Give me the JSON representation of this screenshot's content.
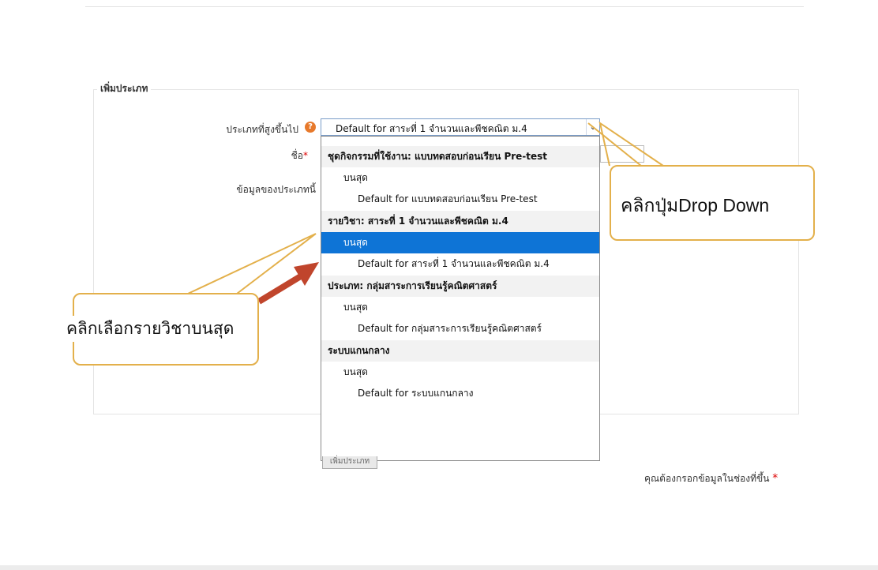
{
  "form": {
    "legend": "เพิ่มประเภท",
    "parent_category_label": "ประเภทที่สูงขึ้นไป",
    "help_icon": "help-icon",
    "name_label": "ชื่อ",
    "required_mark": "*",
    "info_label": "ข้อมูลของประเภทนี้",
    "parent_category_value": "Default for สาระที่ 1 จำนวนและพีชคณิต ม.4",
    "arrow_glyph": "⌄",
    "required_note": "คุณต้องกรอกข้อมูลในช่องที่ขึ้น",
    "hidden_button_label": "เพิ่มประเภท"
  },
  "dropdown": {
    "items": [
      {
        "text": "ชุดกิจกรรมที่ใช้งาน: แบบทดสอบก่อนเรียน  Pre-test",
        "kind": "group"
      },
      {
        "text": "บนสุด",
        "kind": "top"
      },
      {
        "text": "Default for แบบทดสอบก่อนเรียน Pre-test",
        "kind": "default"
      },
      {
        "text": "รายวิชา: สาระที่ 1 จำนวนและพีชคณิต ม.4",
        "kind": "group"
      },
      {
        "text": "บนสุด",
        "kind": "top",
        "selected": true
      },
      {
        "text": "Default for สาระที่ 1 จำนวนและพีชคณิต ม.4",
        "kind": "default"
      },
      {
        "text": "ประเภท: กลุ่มสาระการเรียนรู้คณิตศาสตร์",
        "kind": "group"
      },
      {
        "text": "บนสุด",
        "kind": "top"
      },
      {
        "text": "Default for กลุ่มสาระการเรียนรู้คณิตศาสตร์",
        "kind": "default"
      },
      {
        "text": "ระบบแกนกลาง",
        "kind": "group"
      },
      {
        "text": "บนสุด",
        "kind": "top"
      },
      {
        "text": "Default for ระบบแกนกลาง",
        "kind": "default"
      }
    ]
  },
  "annotations": {
    "dropdown_callout": "คลิกปุ่มDrop Down",
    "select_callout": "คลิกเลือกรายวิชาบนสุด",
    "callout_border_color": "#e3b04b",
    "arrow_color": "#c0452c"
  }
}
